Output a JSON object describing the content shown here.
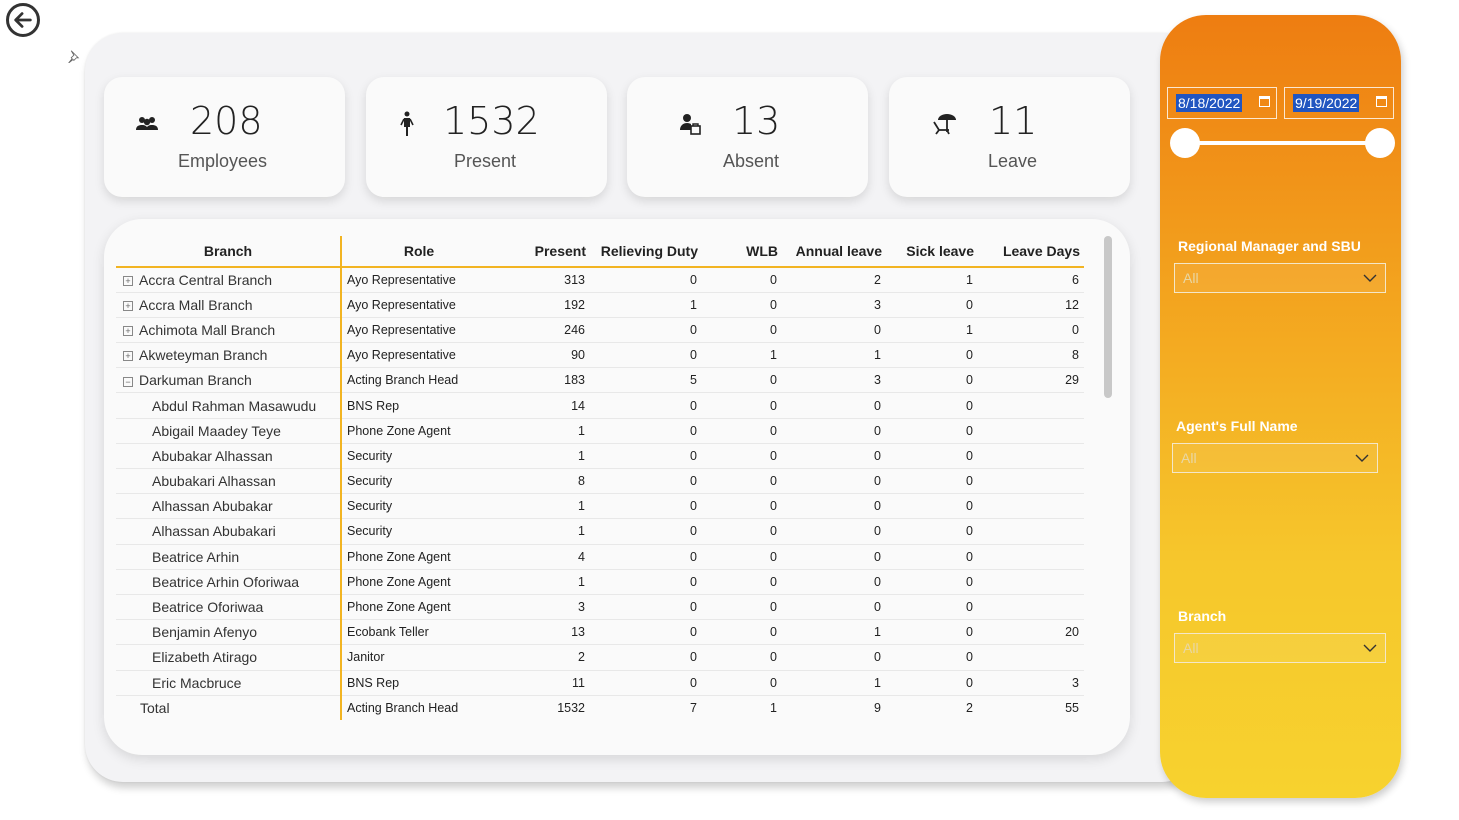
{
  "kpis": [
    {
      "value": "208",
      "label": "Employees",
      "icon": "people-icon"
    },
    {
      "value": "1532",
      "label": "Present",
      "icon": "person-standing-icon"
    },
    {
      "value": "13",
      "label": "Absent",
      "icon": "person-absent-icon"
    },
    {
      "value": "11",
      "label": "Leave",
      "icon": "beach-chair-icon"
    }
  ],
  "table": {
    "headers": [
      "Branch",
      "Role",
      "Present",
      "Relieving Duty",
      "WLB",
      "Annual leave",
      "Sick leave",
      "Leave Days"
    ],
    "rows": [
      {
        "kind": "branch",
        "expand": "+",
        "name": "Accra Central Branch",
        "role": "Ayo Representative",
        "vals": [
          "313",
          "0",
          "0",
          "2",
          "1",
          "6"
        ]
      },
      {
        "kind": "branch",
        "expand": "+",
        "name": "Accra Mall Branch",
        "role": "Ayo Representative",
        "vals": [
          "192",
          "1",
          "0",
          "3",
          "0",
          "12"
        ]
      },
      {
        "kind": "branch",
        "expand": "+",
        "name": "Achimota Mall Branch",
        "role": "Ayo Representative",
        "vals": [
          "246",
          "0",
          "0",
          "0",
          "1",
          "0"
        ]
      },
      {
        "kind": "branch",
        "expand": "+",
        "name": "Akweteyman Branch",
        "role": "Ayo Representative",
        "vals": [
          "90",
          "0",
          "1",
          "1",
          "0",
          "8"
        ]
      },
      {
        "kind": "branch",
        "expand": "−",
        "name": "Darkuman Branch",
        "role": "Acting Branch Head",
        "vals": [
          "183",
          "5",
          "0",
          "3",
          "0",
          "29"
        ]
      },
      {
        "kind": "child",
        "name": "Abdul Rahman Masawudu",
        "role": "BNS Rep",
        "vals": [
          "14",
          "0",
          "0",
          "0",
          "0",
          ""
        ]
      },
      {
        "kind": "child",
        "name": "Abigail Maadey Teye",
        "role": "Phone Zone Agent",
        "vals": [
          "1",
          "0",
          "0",
          "0",
          "0",
          ""
        ]
      },
      {
        "kind": "child",
        "name": "Abubakar Alhassan",
        "role": "Security",
        "vals": [
          "1",
          "0",
          "0",
          "0",
          "0",
          ""
        ]
      },
      {
        "kind": "child",
        "name": "Abubakari Alhassan",
        "role": "Security",
        "vals": [
          "8",
          "0",
          "0",
          "0",
          "0",
          ""
        ]
      },
      {
        "kind": "child",
        "name": "Alhassan Abubakar",
        "role": "Security",
        "vals": [
          "1",
          "0",
          "0",
          "0",
          "0",
          ""
        ]
      },
      {
        "kind": "child",
        "name": "Alhassan Abubakari",
        "role": "Security",
        "vals": [
          "1",
          "0",
          "0",
          "0",
          "0",
          ""
        ]
      },
      {
        "kind": "child",
        "name": "Beatrice Arhin",
        "role": "Phone Zone Agent",
        "vals": [
          "4",
          "0",
          "0",
          "0",
          "0",
          ""
        ]
      },
      {
        "kind": "child",
        "name": "Beatrice Arhin Oforiwaa",
        "role": "Phone Zone Agent",
        "vals": [
          "1",
          "0",
          "0",
          "0",
          "0",
          ""
        ]
      },
      {
        "kind": "child",
        "name": "Beatrice Oforiwaa",
        "role": "Phone Zone Agent",
        "vals": [
          "3",
          "0",
          "0",
          "0",
          "0",
          ""
        ]
      },
      {
        "kind": "child",
        "name": "Benjamin Afenyo",
        "role": "Ecobank Teller",
        "vals": [
          "13",
          "0",
          "0",
          "1",
          "0",
          "20"
        ]
      },
      {
        "kind": "child",
        "name": "Elizabeth Atirago",
        "role": "Janitor",
        "vals": [
          "2",
          "0",
          "0",
          "0",
          "0",
          ""
        ]
      },
      {
        "kind": "child",
        "name": "Eric Macbruce",
        "role": "BNS Rep",
        "vals": [
          "11",
          "0",
          "0",
          "1",
          "0",
          "3"
        ]
      }
    ],
    "total": {
      "name": "Total",
      "role": "Acting Branch Head",
      "vals": [
        "1532",
        "7",
        "1",
        "9",
        "2",
        "55"
      ]
    }
  },
  "filters": {
    "date_start": "8/18/2022",
    "date_end": "9/19/2022",
    "regional_label": "Regional Manager and SBU",
    "regional_value": "All",
    "agent_label": "Agent's Full Name",
    "agent_value": "All",
    "branch_label": "Branch",
    "branch_value": "All"
  },
  "colors": {
    "accent": "#f2b422",
    "sidebar_top": "#ee7d11",
    "sidebar_bottom": "#f7d22e",
    "date_highlight": "#2155c0"
  }
}
